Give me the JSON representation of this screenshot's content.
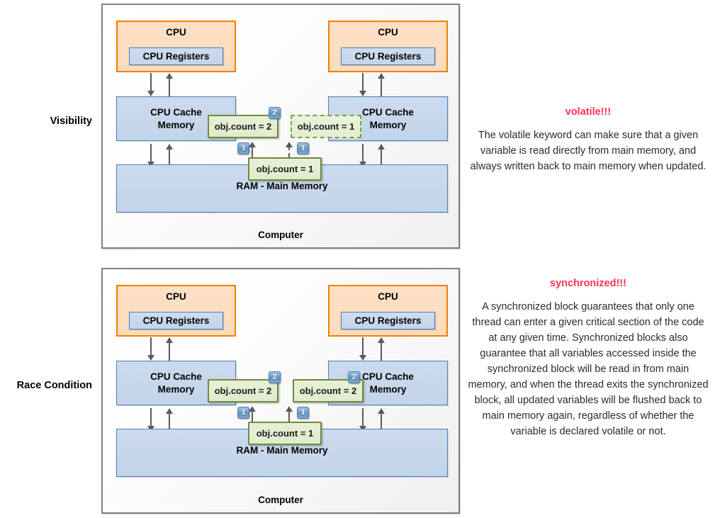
{
  "rows": [
    {
      "id": "visibility",
      "label": "Visibility"
    },
    {
      "id": "race",
      "label": "Race Condition"
    }
  ],
  "diagram": {
    "computer_caption": "Computer",
    "cpu_title": "CPU",
    "registers_label": "CPU Registers",
    "cache_label_line1": "CPU Cache",
    "cache_label_line2": "Memory",
    "ram_label": "RAM - Main Memory"
  },
  "visibility_diagram": {
    "cache_left_value": "obj.count = 2",
    "cache_left_badge": "2",
    "cache_right_value": "obj.count = 1",
    "ram_value": "obj.count = 1",
    "badge_left_step": "1",
    "badge_right_step": "1"
  },
  "race_diagram": {
    "cache_left_value": "obj.count = 2",
    "cache_left_badge": "2",
    "cache_right_value": "obj.count = 2",
    "cache_right_badge": "2",
    "ram_value": "obj.count = 1",
    "badge_left_step": "1",
    "badge_right_step": "1"
  },
  "explanations": [
    {
      "title": "volatile!!!",
      "body": "The volatile keyword can make sure that a given variable is read directly from main memory, and always written back to main memory when updated."
    },
    {
      "title": "synchronized!!!",
      "body": "A synchronized block guarantees that only one thread can enter a given critical section of the code at any given time. Synchronized blocks also guarantee that all variables accessed inside the synchronized block will be read in from main memory, and when the thread exits the synchronized block, all updated variables will be flushed back to main memory again, regardless of whether the variable is declared volatile or not."
    }
  ],
  "colors": {
    "cpu_border": "#F08000",
    "cpu_fill": "#fbdcbe",
    "box_border": "#4A7EBB",
    "box_fill": "#c3d4ea",
    "green_border": "#6E8B3D",
    "green_fill": "#dfeccb",
    "badge_fill": "#6f9ec8",
    "accent_red": "#FF3355",
    "panel_border": "#808080"
  }
}
